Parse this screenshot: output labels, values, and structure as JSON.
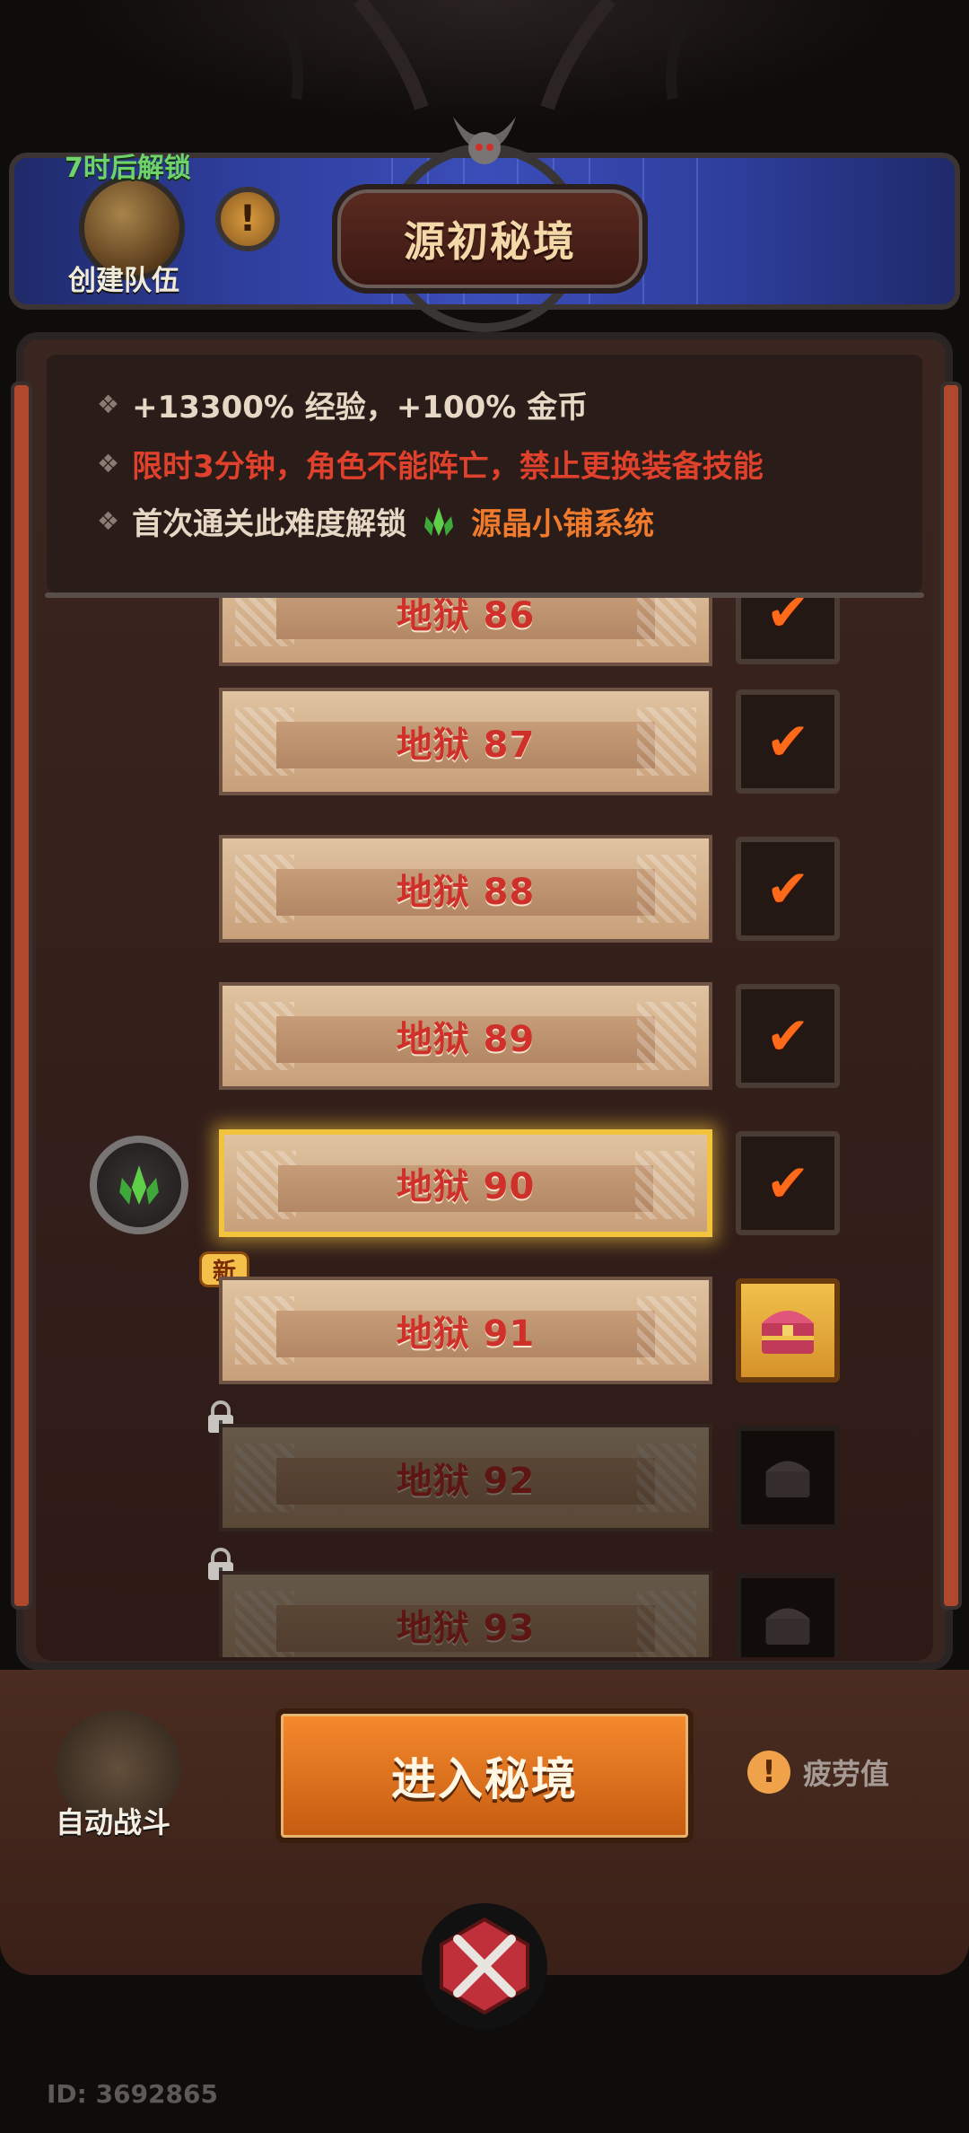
{
  "header": {
    "title": "源初秘境",
    "unlock_timer": "7时后解锁",
    "team_label": "创建队伍",
    "info_icon": "exclamation-icon"
  },
  "rules": {
    "line1": "+13300% 经验，+100% 金币",
    "line2": "限时3分钟，角色不能阵亡，禁止更换装备技能",
    "line3_prefix": "首次通关此难度解锁",
    "line3_highlight": "源晶小铺系统"
  },
  "levels": [
    {
      "name": "地狱 86",
      "state": "cleared"
    },
    {
      "name": "地狱 87",
      "state": "cleared"
    },
    {
      "name": "地狱 88",
      "state": "cleared"
    },
    {
      "name": "地狱 89",
      "state": "cleared"
    },
    {
      "name": "地狱 90",
      "state": "selected-cleared"
    },
    {
      "name": "地狱 91",
      "state": "new",
      "badge": "新"
    },
    {
      "name": "地狱 92",
      "state": "locked"
    },
    {
      "name": "地狱 93",
      "state": "locked"
    }
  ],
  "bottom": {
    "auto_battle_label": "自动战斗",
    "enter_button_label": "进入秘境",
    "fatigue_label": "疲劳值"
  },
  "footer": {
    "user_id": "ID: 3692865"
  },
  "colors": {
    "accent_orange": "#f07b2c",
    "warning_red": "#e0412c",
    "unlock_green": "#6fd36a",
    "selected_gold": "#f2c33d"
  }
}
